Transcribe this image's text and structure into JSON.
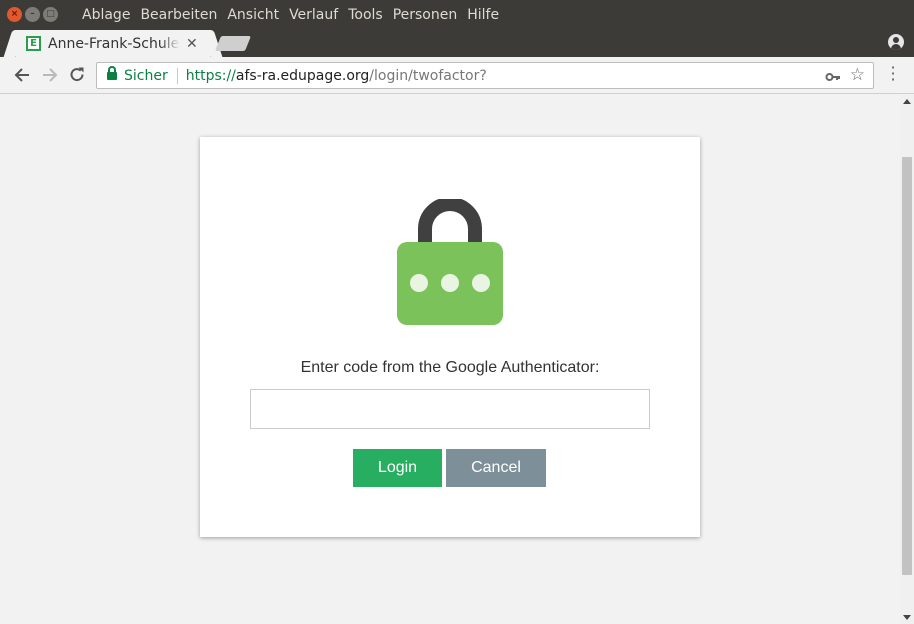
{
  "window": {
    "menu": [
      "Ablage",
      "Bearbeiten",
      "Ansicht",
      "Verlauf",
      "Tools",
      "Personen",
      "Hilfe"
    ]
  },
  "tabs": [
    {
      "title": "Anne-Frank-Schule",
      "favicon_letter": "E",
      "active": true
    }
  ],
  "address_bar": {
    "security_label": "Sicher",
    "url_scheme": "https://",
    "url_host": "afs-ra.edupage.org",
    "url_path": "/login/twofactor?"
  },
  "page": {
    "prompt": "Enter code from the Google Authenticator:",
    "code_input": {
      "value": "",
      "placeholder": ""
    },
    "login_label": "Login",
    "cancel_label": "Cancel"
  },
  "icons": {
    "padlock": "padlock-icon",
    "colors": {
      "lock_body": "#7cc25a",
      "lock_shackle": "#404040",
      "login_button": "#27ae60",
      "cancel_button": "#7d909a",
      "secure_green": "#0b8043"
    }
  }
}
